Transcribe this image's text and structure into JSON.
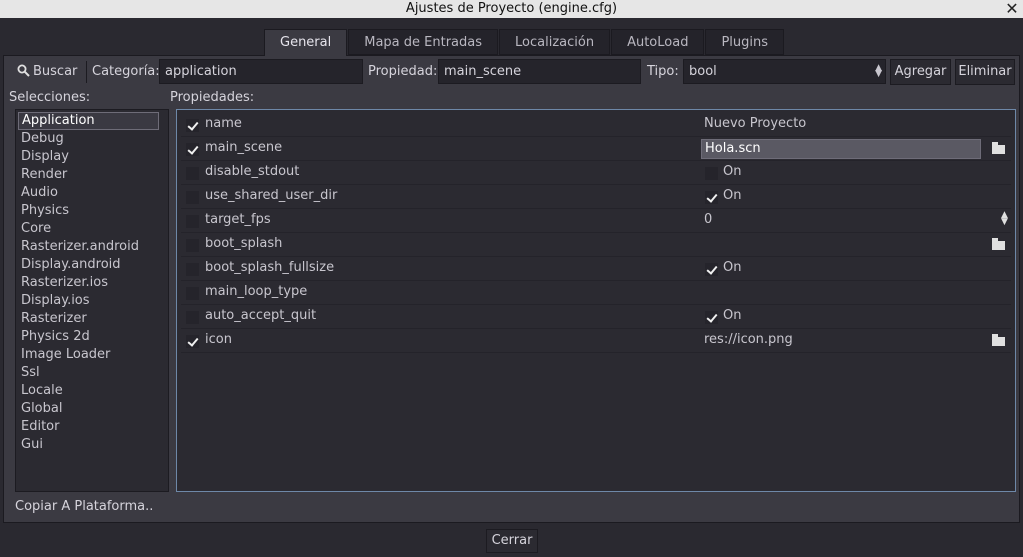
{
  "window": {
    "title": "Ajustes de Proyecto (engine.cfg)",
    "close_glyph": "✕"
  },
  "tabs": [
    {
      "label": "General",
      "active": true
    },
    {
      "label": "Mapa de Entradas",
      "active": false
    },
    {
      "label": "Localización",
      "active": false
    },
    {
      "label": "AutoLoad",
      "active": false
    },
    {
      "label": "Plugins",
      "active": false
    }
  ],
  "toolbar": {
    "search_label": "Buscar",
    "category_label": "Categoría:",
    "category_value": "application",
    "property_label": "Propiedad:",
    "property_value": "main_scene",
    "type_label": "Tipo:",
    "type_value": "bool",
    "add_label": "Agregar",
    "remove_label": "Eliminar"
  },
  "selections": {
    "label": "Selecciones:",
    "items": [
      "Application",
      "Debug",
      "Display",
      "Render",
      "Audio",
      "Physics",
      "Core",
      "Rasterizer.android",
      "Display.android",
      "Rasterizer.ios",
      "Display.ios",
      "Rasterizer",
      "Physics 2d",
      "Image Loader",
      "Ssl",
      "Locale",
      "Global",
      "Editor",
      "Gui"
    ],
    "selected_index": 0
  },
  "properties": {
    "label": "Propiedades:",
    "rows": [
      {
        "name": "name",
        "checked": true,
        "value": "Nuevo Proyecto",
        "kind": "text"
      },
      {
        "name": "main_scene",
        "checked": true,
        "value": "Hola.scn",
        "kind": "file-edit"
      },
      {
        "name": "disable_stdout",
        "checked": false,
        "value": "On",
        "value_checked": false,
        "kind": "bool"
      },
      {
        "name": "use_shared_user_dir",
        "checked": false,
        "value": "On",
        "value_checked": true,
        "kind": "bool"
      },
      {
        "name": "target_fps",
        "checked": false,
        "value": "0",
        "kind": "spin"
      },
      {
        "name": "boot_splash",
        "checked": false,
        "value": "",
        "kind": "file"
      },
      {
        "name": "boot_splash_fullsize",
        "checked": false,
        "value": "On",
        "value_checked": true,
        "kind": "bool"
      },
      {
        "name": "main_loop_type",
        "checked": false,
        "value": "",
        "kind": "text"
      },
      {
        "name": "auto_accept_quit",
        "checked": false,
        "value": "On",
        "value_checked": true,
        "kind": "bool"
      },
      {
        "name": "icon",
        "checked": true,
        "value": "res://icon.png",
        "kind": "file"
      }
    ]
  },
  "footer": {
    "copy_label": "Copiar A Plataforma..",
    "close_label": "Cerrar"
  },
  "colors": {
    "background": "#2a2930",
    "panel": "#3b3a42",
    "list": "#2b2a31",
    "accent_border": "#6e88a8"
  }
}
